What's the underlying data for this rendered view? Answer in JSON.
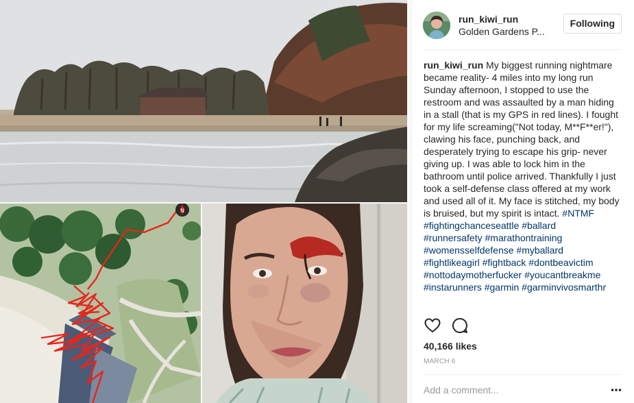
{
  "post": {
    "username": "run_kiwi_run",
    "location": "Golden Gardens P...",
    "follow_label": "Following",
    "caption": {
      "username": "run_kiwi_run",
      "text": " My biggest running nightmare became reality- 4 miles into my long run Sunday afternoon, I stopped to use the restroom and was assaulted by a man hiding in a stall (that is my GPS in red lines). I fought for my life screaming(\"Not today, M**F**er!\"), clawing his face, punching back, and desperately trying to escape his grip- never giving up. I was able to lock him in the bathroom until police arrived. Thankfully I just took a self-defense class offered at my work and used all of it. My face is stitched, my body is bruised, but my spirit is intact. ",
      "inline_tag": "#NTMF",
      "tag_lines": [
        "#fightingchanceseattle #ballard",
        "#runnersafety #marathontraining",
        "#womensselfdefense #myballard",
        "#fightlikeagirl #fightback #dontbeavictim",
        "#nottodaymotherfucker #youcantbreakme",
        "#instarunners #garmin #garminvivosmarthr"
      ]
    },
    "likes": "40,166 likes",
    "date": "MARCH 6",
    "comment_placeholder": "Add a comment..."
  },
  "icons": {
    "like": "heart-icon",
    "comment": "speech-bubble-icon",
    "more": "ellipsis-icon",
    "compass": "compass-icon"
  },
  "colors": {
    "gps_track": "#e8251b",
    "link": "#003569",
    "muted": "#999999"
  },
  "map": {
    "compass_label": "N"
  }
}
